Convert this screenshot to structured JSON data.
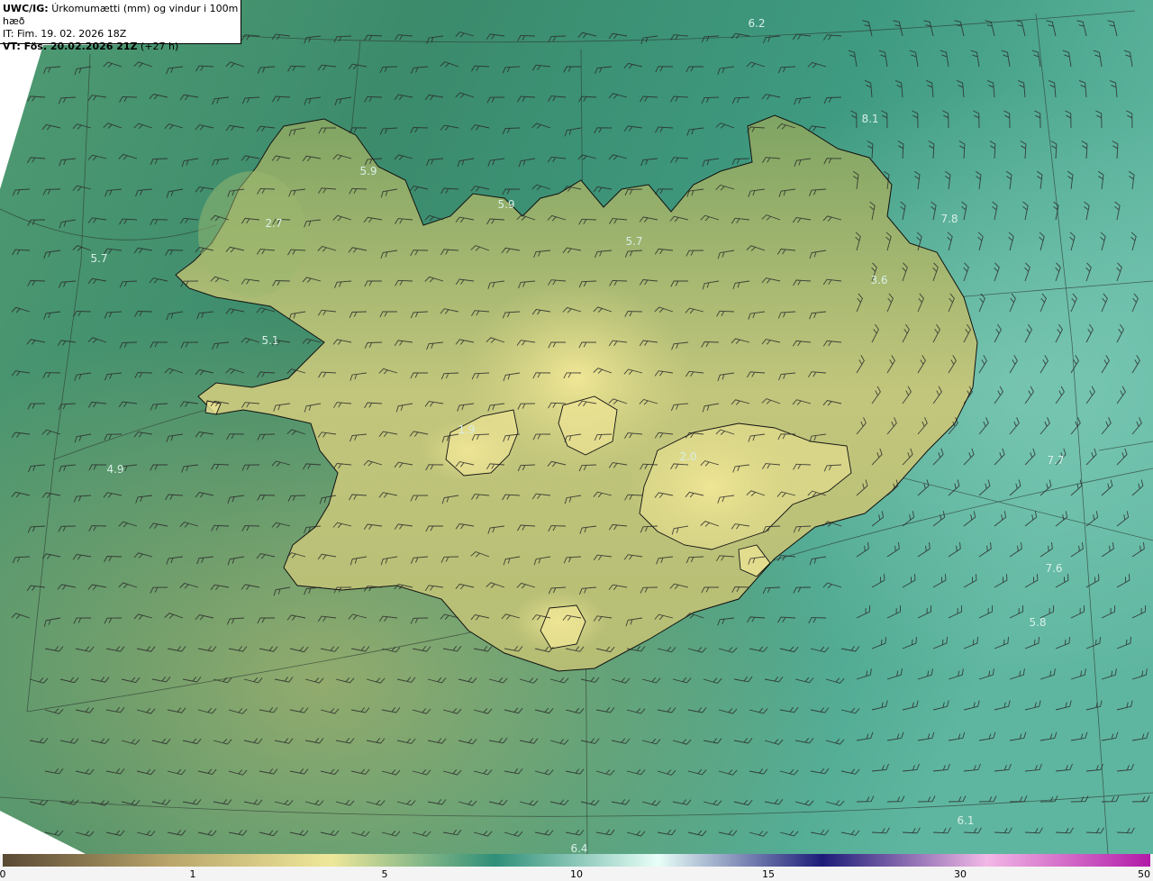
{
  "header": {
    "model_label": "UWC/IG:",
    "title": "Úrkomumætti (mm) og vindur i 100m hæð",
    "init_time": "IT: Fim. 19. 02. 2026 18Z",
    "valid_label": "VT: Fös. 20.02.2026 21Z",
    "valid_offset": "(+27 h)"
  },
  "map_values": [
    "6.2",
    "8.1",
    "5.9",
    "2.7",
    "5.7",
    "5.9",
    "5.7",
    "7.8",
    "3.6",
    "5.1",
    "1.9",
    "4.9",
    "2.0",
    "7.7",
    "7.6",
    "5.8",
    "6.1",
    "6.4"
  ],
  "colorbar": {
    "ticks": [
      "0",
      "1",
      "5",
      "10",
      "15",
      "30",
      "50"
    ],
    "colors": [
      "#5a4a35",
      "#b8a46a",
      "#efe89a",
      "#2f8f78",
      "#e8fff8",
      "#1c1c78",
      "#f2b8e6",
      "#b21aa8"
    ]
  },
  "colors": {
    "ocean_dark": "#2b7a62",
    "ocean_light": "#77c7b0",
    "land_low": "#8aa964",
    "land_high": "#ece394",
    "label": "#d7efe6"
  }
}
